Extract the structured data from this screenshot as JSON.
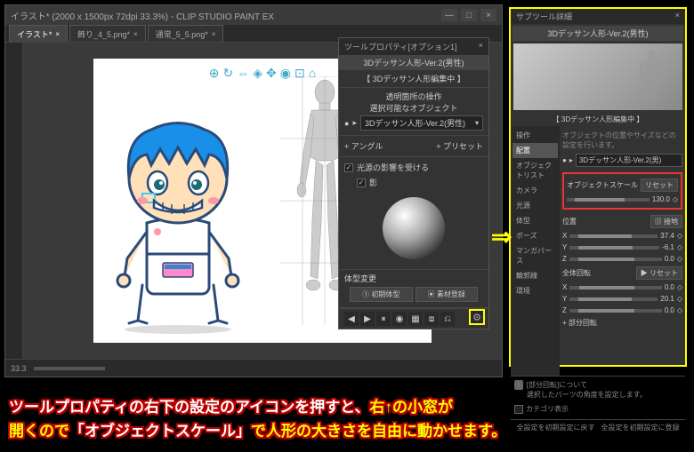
{
  "window": {
    "title": "イラスト* (2000 x 1500px 72dpi 33.3%) - CLIP STUDIO PAINT EX",
    "min": "—",
    "max": "□",
    "close": "×"
  },
  "tabs": [
    {
      "label": "イラスト*",
      "active": true
    },
    {
      "label": "飾り_4_5.png*",
      "active": false
    },
    {
      "label": "通常_5_5.png*",
      "active": false
    }
  ],
  "status": {
    "zoom": "33.3"
  },
  "tool_property": {
    "panel_title": "ツールプロパティ[オプション1]",
    "head": "3Dデッサン人形-Ver.2(男性)",
    "sub_head": "【 3Dデッサン人形編集中 】",
    "section1_title": "透明箇所の操作",
    "section1_sub": "選択可能なオブジェクト",
    "eye": "●",
    "object_name": "3Dデッサン人形-Ver.2(男性)",
    "angle_label": "+ アングル",
    "preset_label": "+ プリセット",
    "light_label": "光源の影響を受ける",
    "shadow_label": "影",
    "body_change_label": "体型変更",
    "btn_init": "① 初期体型",
    "btn_register": "▣ 素材登録",
    "icons": [
      "◀",
      "▶",
      "⏸",
      "◉",
      "▦",
      "⧈",
      "⎌"
    ]
  },
  "sub_tool": {
    "title": "サブツール詳細",
    "close": "×",
    "head": "3Dデッサン人形-Ver.2(男性)",
    "sub_head": "【 3Dデッサン人形編集中 】",
    "sidebar": [
      "操作",
      "配置",
      "オブジェクトリスト",
      "カメラ",
      "光源",
      "体型",
      "ポーズ",
      "マンガパース",
      "輪郭線",
      "環境"
    ],
    "sidebar_selected": 1,
    "note": "オブジェクトの位置やサイズなどの設定を行います。",
    "eye": "●",
    "object_name": "3Dデッサン人形-Ver.2(男)",
    "scale_label": "オブジェクトスケール",
    "reset": "リセット",
    "scale_value": "130.0",
    "position_label": "位置",
    "ground_btn": "▥ 接地",
    "x_label": "X",
    "x_val": "37.4",
    "y_label": "Y",
    "y_val": "-6.1",
    "z_label": "Z",
    "z_val": "0.0",
    "rotation_label": "全体回転",
    "rot_reset": "▶ リセット",
    "rx": "X",
    "rx_val": "0.0",
    "ry": "Y",
    "ry_val": "20.1",
    "rz": "Z",
    "rz_val": "0.0",
    "partial_label": "+ 部分回転",
    "info_title": "[部分回転]について",
    "info_text": "選択したパーツの角度を設定します。",
    "category_label": "カテゴリ表示",
    "footer1": "全設定を初期設定に戻す",
    "footer2": "全設定を初期設定に登録"
  },
  "caption": {
    "line1_a": "ツールプロパティの右下の設定のアイコンを押すと、",
    "line1_b": "右↑の小窓が",
    "line2_a": "開くので",
    "line2_b": "「オブジェクトスケール」",
    "line2_c": "で人形の大きさを自由に動かせます。"
  }
}
